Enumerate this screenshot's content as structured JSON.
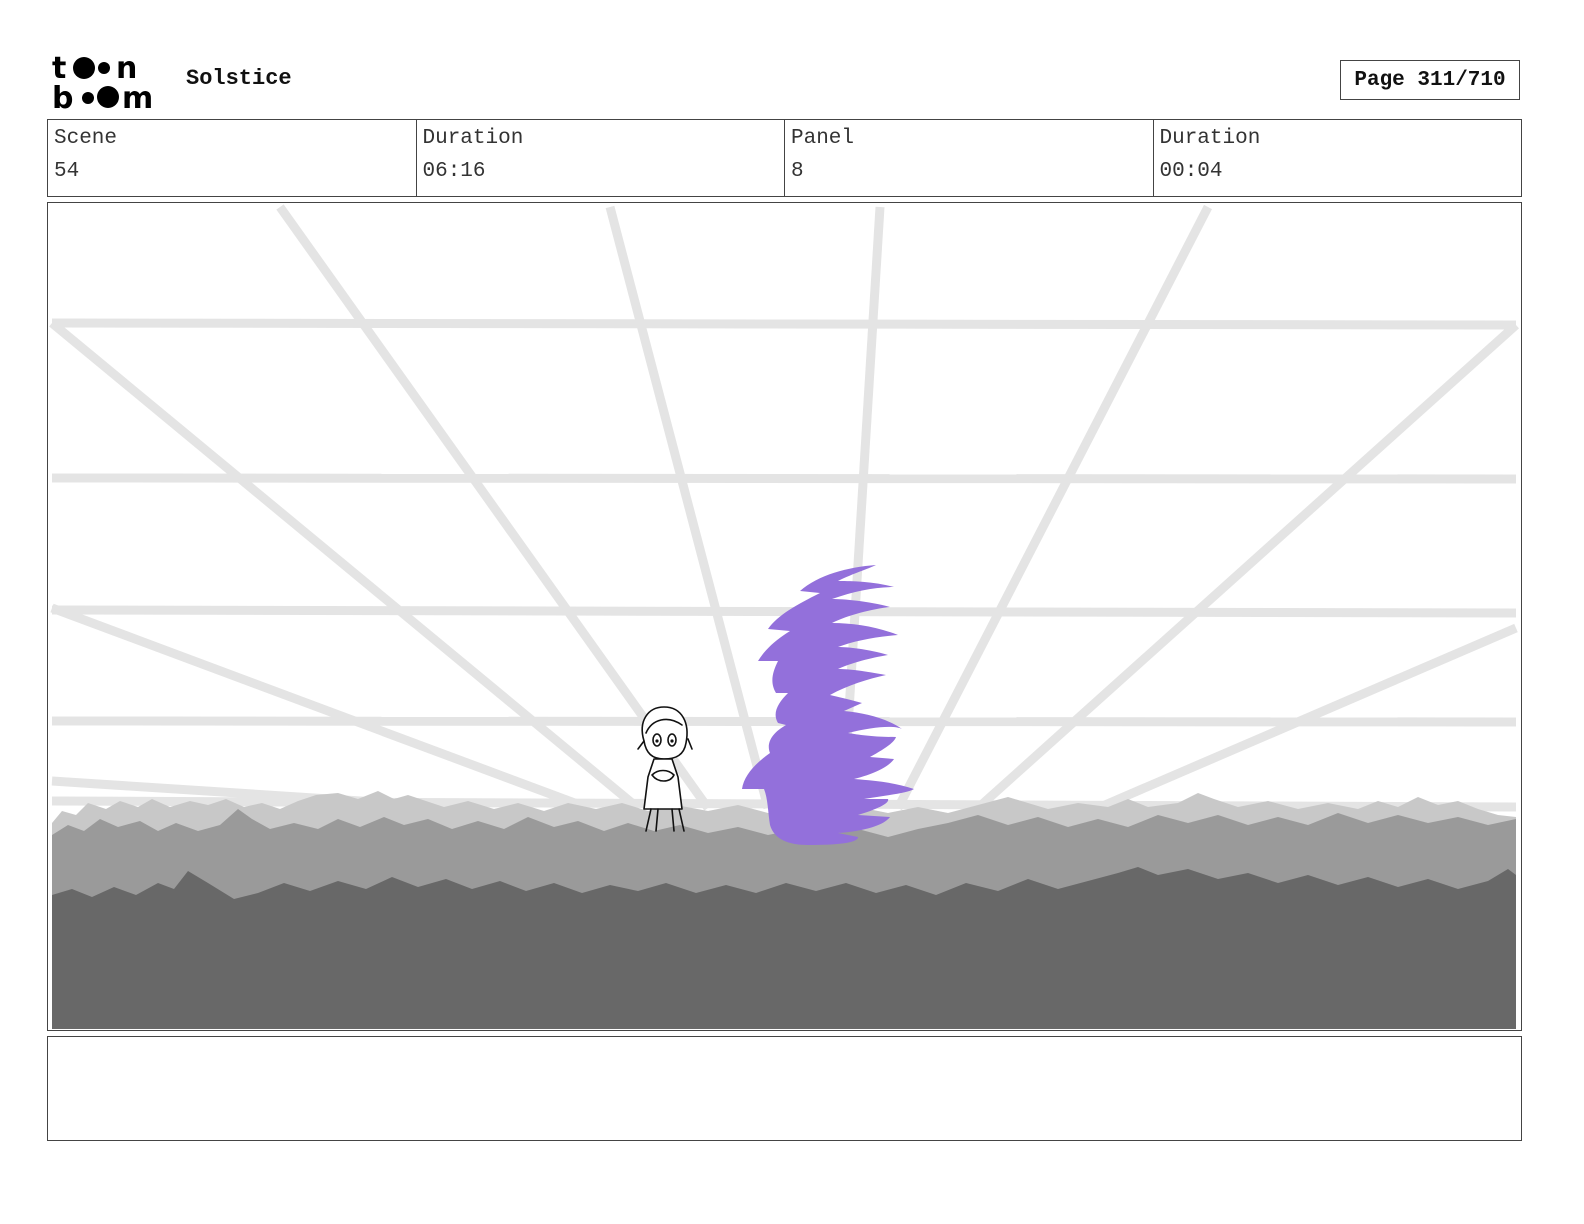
{
  "header": {
    "logo_text": [
      "t",
      "n",
      "b",
      "m"
    ],
    "project_title": "Solstice",
    "page_label": "Page 311/710"
  },
  "info": {
    "scene_label": "Scene",
    "scene_value": "54",
    "scene_duration_label": "Duration",
    "scene_duration_value": "06:16",
    "panel_label": "Panel",
    "panel_value": "8",
    "panel_duration_label": "Duration",
    "panel_duration_value": "00:04"
  },
  "panel": {
    "colors": {
      "grid": "#e4e4e4",
      "ground_light": "#c8c8c8",
      "ground_mid": "#9a9a9a",
      "ground_dark": "#686868",
      "purple_figure": "#9370db",
      "line_art": "#111111"
    }
  },
  "notes": {
    "text": ""
  }
}
